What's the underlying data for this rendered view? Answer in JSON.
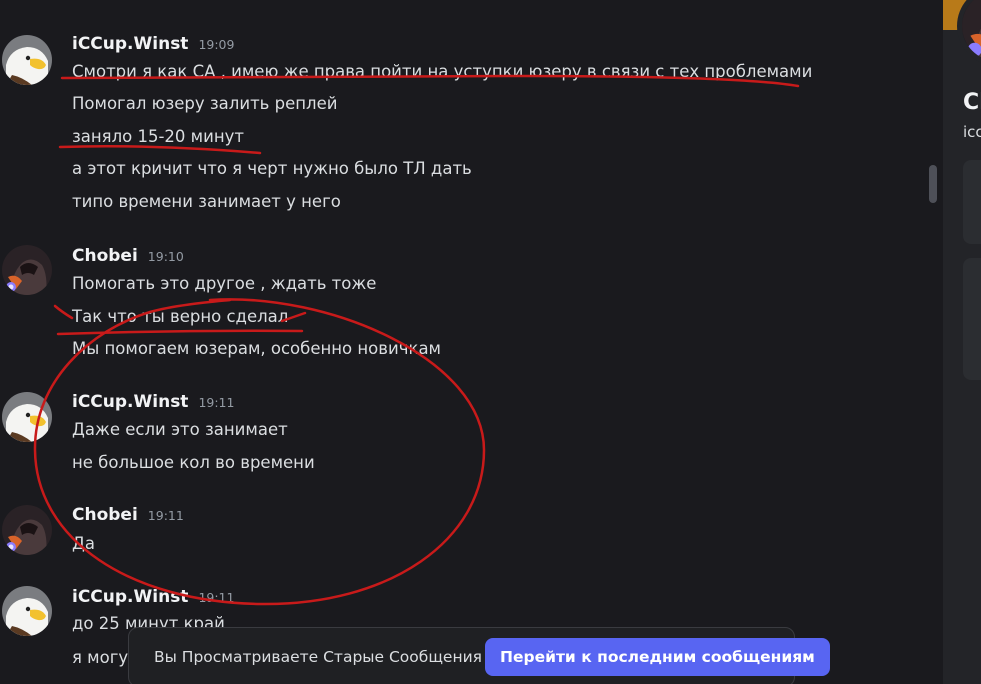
{
  "messages": [
    {
      "username": "iCCup.Winst",
      "time": "19:09",
      "avatar_icon": "eagle-icon",
      "lines": [
        "Смотри я как СА , имею же права пойти на уступки юзеру в связи с тех проблемами",
        "Помогал юзеру залить реплей",
        "заняло 15-20 минут",
        "а этот кричит что я черт нужно было ТЛ дать",
        "типо времени занимает у него"
      ]
    },
    {
      "username": "Chobei",
      "time": "19:10",
      "avatar_icon": "dark-character-icon",
      "lines": [
        "Помогать это другое , ждать тоже",
        "Так что ты верно сделал",
        "Мы помогаем юзерам, особенно новичкам"
      ]
    },
    {
      "username": "iCCup.Winst",
      "time": "19:11",
      "avatar_icon": "eagle-icon",
      "lines": [
        "Даже если это занимает",
        "не большое кол во времени"
      ]
    },
    {
      "username": "Chobei",
      "time": "19:11",
      "avatar_icon": "dark-character-icon",
      "lines": [
        "Да"
      ]
    },
    {
      "username": "iCCup.Winst",
      "time": "19:11",
      "avatar_icon": "eagle-icon",
      "lines": [
        "до 25 минут край",
        "я могу"
      ]
    }
  ],
  "old_messages_bar": {
    "text": "Вы Просматриваете Старые Сообщения",
    "button_label": "Перейти к последним сообщениям"
  },
  "profile_panel": {
    "name": "Ch",
    "handle": "icc"
  },
  "colors": {
    "background": "#1a1a1e",
    "accent": "#5865f2",
    "annotation": "#c81a1a",
    "banner_orange": "#b87a19"
  }
}
